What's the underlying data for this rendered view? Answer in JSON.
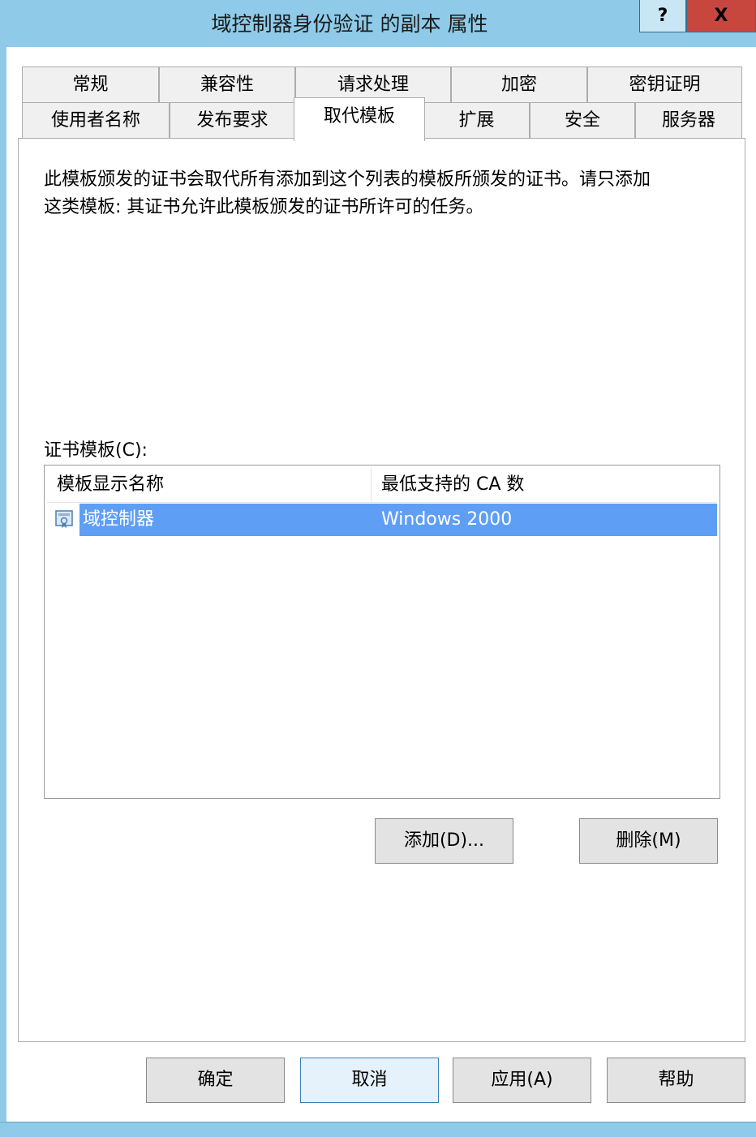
{
  "window": {
    "title": "域控制器身份验证 的副本 属性",
    "help_label": "?",
    "close_label": "X"
  },
  "tabs_row1": [
    "常规",
    "兼容性",
    "请求处理",
    "加密",
    "密钥证明"
  ],
  "tabs_row2": [
    "使用者名称",
    "发布要求",
    "取代模板",
    "扩展",
    "安全",
    "服务器"
  ],
  "active_tab": "取代模板",
  "panel": {
    "description_line1": "此模板颁发的证书会取代所有添加到这个列表的模板所颁发的证书。请只添加",
    "description_line2": "这类模板: 其证书允许此模板颁发的证书所许可的任务。",
    "list_label": "证书模板(C):",
    "columns": [
      "模板显示名称",
      "最低支持的 CA  数"
    ],
    "rows": [
      {
        "name": "域控制器",
        "min_ca": "Windows 2000",
        "selected": true,
        "icon": "certificate-template-icon"
      }
    ],
    "add_button": "添加(D)...",
    "remove_button": "删除(M)"
  },
  "footer": {
    "ok": "确定",
    "cancel": "取消",
    "apply": "应用(A)",
    "help": "帮助"
  },
  "colors": {
    "titlebar": "#8fcbe8",
    "close_button": "#c7473f",
    "selection": "#5e9ef5"
  }
}
